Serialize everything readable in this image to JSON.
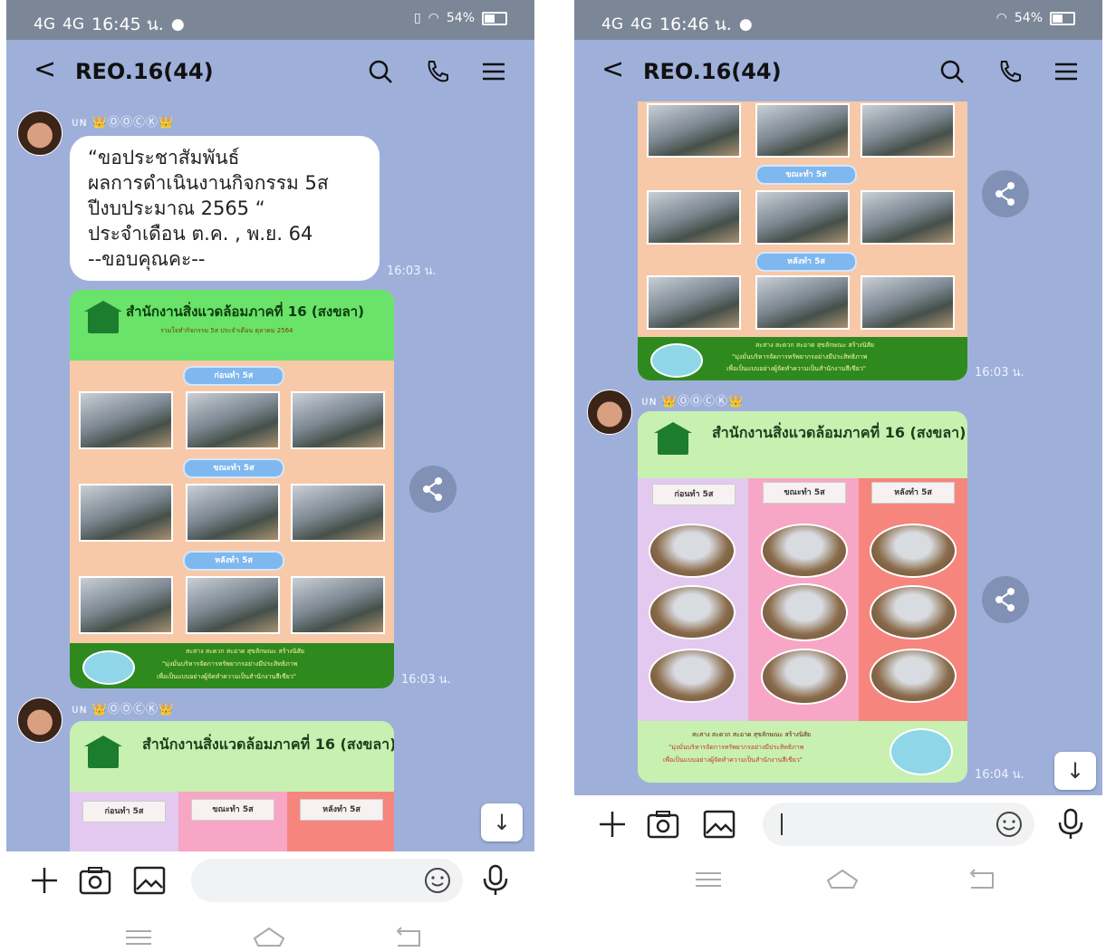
{
  "left": {
    "status": {
      "network1": "4G",
      "network2": "4G",
      "time": "16:45 น.",
      "battery": "54%"
    },
    "header": {
      "title": "REO.16(44)"
    },
    "msg1": {
      "sender": "ᴜɴ 👑ⓄⓄⒸⓀ👑",
      "text": "“ขอประชาสัมพันธ์\nผลการดำเนินงานกิจกรรม 5ส\nปีงบประมาณ 2565 “\nประจำเดือน ต.ค. , พ.ย. 64\n--ขอบคุณคะ--",
      "time": "16:03 น."
    },
    "poster1": {
      "title": "สำนักงานสิ่งแวดล้อมภาคที่ 16 (สงขลา)",
      "subtitle": "ร่วมใจทำกิจกรรม 5ส ประจำเดือน ตุลาคม 2564",
      "pills": [
        "ก่อนทำ 5ส",
        "ขณะทำ 5ส",
        "หลังทำ 5ส"
      ],
      "footer": [
        "สะสาง สะดวก สะอาด สุขลักษณะ สร้างนิสัย",
        "\"มุ่งมั่นบริหารจัดการทรัพยากรอย่างมีประสิทธิภาพ",
        "เพื่อเป็นแบบอย่างผู้จัดทำความเป็นสำนักงานสีเขียว\""
      ],
      "time": "16:03 น."
    },
    "msg3": {
      "sender": "ᴜɴ 👑ⓄⓄⒸⓀ👑"
    },
    "poster2": {
      "title": "สำนักงานสิ่งแวดล้อมภาคที่ 16 (สงขลา)",
      "cols": [
        "ก่อนทำ 5ส",
        "ขณะทำ 5ส",
        "หลังทำ 5ส"
      ]
    }
  },
  "right": {
    "status": {
      "network1": "4G",
      "network2": "4G",
      "time": "16:46 น.",
      "battery": "54%"
    },
    "header": {
      "title": "REO.16(44)"
    },
    "poster1": {
      "pills": [
        "ขณะทำ 5ส",
        "หลังทำ 5ส"
      ],
      "footer": [
        "สะสาง สะดวก สะอาด สุขลักษณะ สร้างนิสัย",
        "\"มุ่งมั่นบริหารจัดการทรัพยากรอย่างมีประสิทธิภาพ",
        "เพื่อเป็นแบบอย่างผู้จัดทำความเป็นสำนักงานสีเขียว\""
      ],
      "time": "16:03 น."
    },
    "msg2": {
      "sender": "ᴜɴ 👑ⓄⓄⒸⓀ👑"
    },
    "poster2": {
      "title": "สำนักงานสิ่งแวดล้อมภาคที่ 16 (สงขลา)",
      "cols": [
        "ก่อนทำ 5ส",
        "ขณะทำ 5ส",
        "หลังทำ 5ส"
      ],
      "footer": [
        "สะสาง สะดวก สะอาด สุขลักษณะ สร้างนิสัย",
        "\"มุ่งมั่นบริหารจัดการทรัพยากรอย่างมีประสิทธิภาพ",
        "เพื่อเป็นแบบอย่างผู้จัดทำความเป็นสำนักงานสีเขียว\""
      ],
      "time": "16:04 น."
    }
  },
  "colors": {
    "chat_bg": "#9eb0da",
    "header_bg": "#9eb0da",
    "poster_green": "#69e36a",
    "poster_orange": "#f7c9a8",
    "footer_green": "#2e8a1e",
    "col_purple": "#e3c9ef",
    "col_pink": "#f7a6c6",
    "col_red": "#f6857e"
  },
  "icons": [
    "back-icon",
    "search-icon",
    "phone-icon",
    "menu-icon",
    "share-icon",
    "scroll-down-icon",
    "plus-icon",
    "camera-icon",
    "image-icon",
    "emoji-icon",
    "mic-icon",
    "nav-menu-icon",
    "nav-home-icon",
    "nav-back-icon"
  ]
}
